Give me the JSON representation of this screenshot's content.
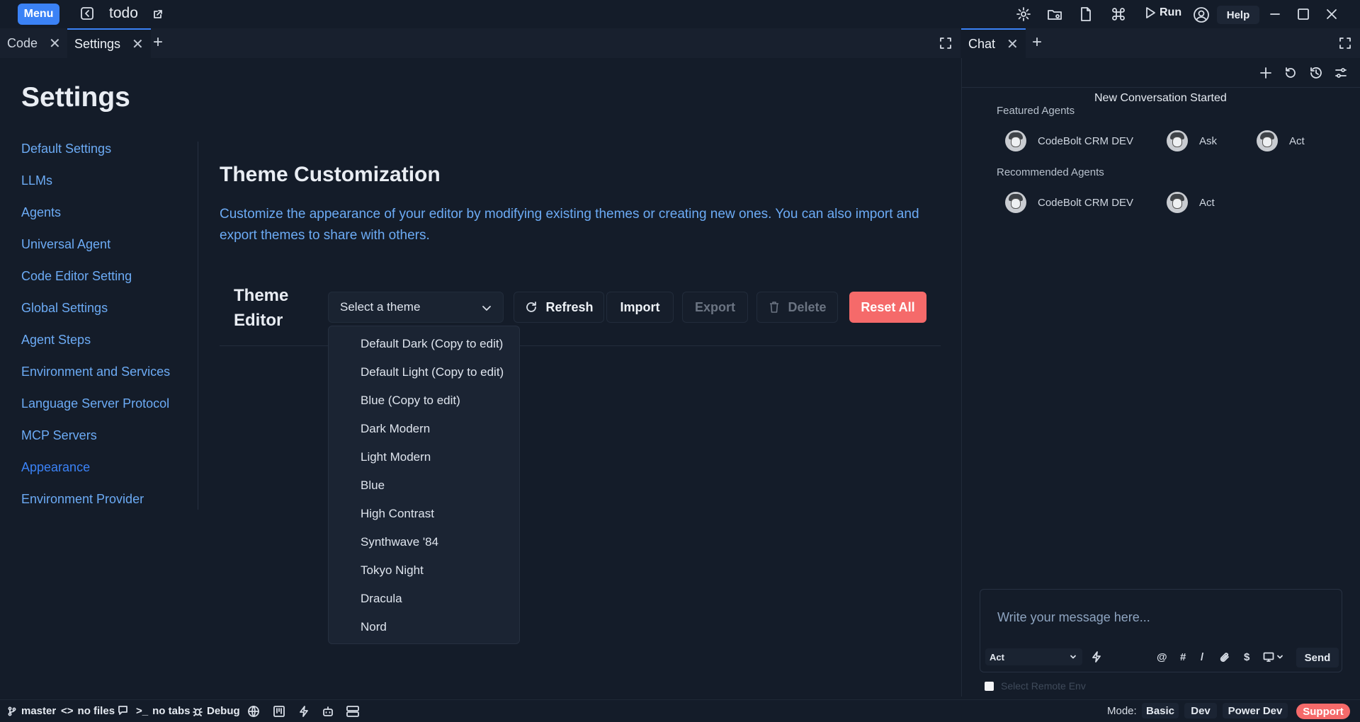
{
  "topbar": {
    "menu_label": "Menu",
    "project_name": "todo",
    "run_label": "Run",
    "help_label": "Help",
    "icons": [
      "back-icon",
      "external-link-icon",
      "gear-icon",
      "folder-settings-icon",
      "file-icon",
      "command-icon",
      "play-icon",
      "user-circle-icon",
      "minimize-icon",
      "maximize-icon",
      "close-icon"
    ]
  },
  "editor_tabs": [
    {
      "label": "Code",
      "active": false
    },
    {
      "label": "Settings",
      "active": true
    }
  ],
  "chat_tabs": [
    {
      "label": "Chat",
      "active": true
    }
  ],
  "settings": {
    "title": "Settings",
    "nav": [
      {
        "label": "Default Settings"
      },
      {
        "label": "LLMs"
      },
      {
        "label": "Agents"
      },
      {
        "label": "Universal Agent"
      },
      {
        "label": "Code Editor Setting"
      },
      {
        "label": "Global Settings"
      },
      {
        "label": "Agent Steps"
      },
      {
        "label": "Environment and Services"
      },
      {
        "label": "Language Server Protocol"
      },
      {
        "label": "MCP Servers"
      },
      {
        "label": "Appearance",
        "active": true
      },
      {
        "label": "Environment Provider"
      }
    ],
    "heading": "Theme Customization",
    "description": "Customize the appearance of your editor by modifying existing themes or creating new ones. You can also import and export themes to share with others.",
    "editor_label_line1": "Theme",
    "editor_label_line2": "Editor",
    "select_placeholder": "Select a theme",
    "buttons": {
      "refresh": "Refresh",
      "import": "Import",
      "export": "Export",
      "delete": "Delete",
      "reset_all": "Reset All"
    },
    "theme_options": [
      "Default Dark (Copy to edit)",
      "Default Light (Copy to edit)",
      "Blue (Copy to edit)",
      "Dark Modern",
      "Light Modern",
      "Blue",
      "High Contrast",
      "Synthwave '84",
      "Tokyo Night",
      "Dracula",
      "Nord"
    ]
  },
  "chat": {
    "conversation_status": "New Conversation Started",
    "featured_label": "Featured Agents",
    "featured_agents": [
      "CodeBolt CRM DEV",
      "Ask",
      "Act"
    ],
    "recommended_label": "Recommended Agents",
    "recommended_agents": [
      "CodeBolt CRM DEV",
      "Act"
    ],
    "message_placeholder": "Write your message here...",
    "agent_select_value": "Act",
    "tools": [
      "@",
      "#",
      "/",
      "$"
    ],
    "send_label": "Send",
    "remote_env_label": "Select Remote Env"
  },
  "statusbar": {
    "branch": "master",
    "files": "no files",
    "tabs": "no tabs",
    "debug": "Debug",
    "mode_label": "Mode:",
    "modes": [
      "Basic",
      "Dev",
      "Power Dev"
    ],
    "support": "Support"
  },
  "colors": {
    "background": "#141c29",
    "accent": "#3b82f6",
    "link": "#6cabf5",
    "danger": "#f56a6a"
  }
}
